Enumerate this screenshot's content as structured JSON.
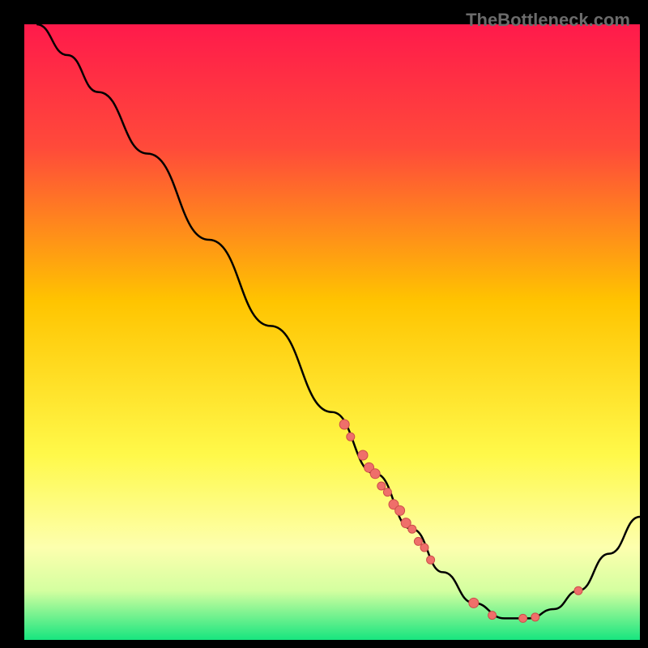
{
  "watermark": "TheBottleneck.com",
  "chart_data": {
    "type": "line",
    "title": "",
    "xlabel": "",
    "ylabel": "",
    "xlim": [
      0,
      100
    ],
    "ylim": [
      0,
      100
    ],
    "background_gradient": {
      "stops": [
        {
          "pct": 0,
          "color": "#ff1a4b"
        },
        {
          "pct": 20,
          "color": "#ff4a3a"
        },
        {
          "pct": 45,
          "color": "#ffc400"
        },
        {
          "pct": 70,
          "color": "#fff94a"
        },
        {
          "pct": 85,
          "color": "#fdffae"
        },
        {
          "pct": 92,
          "color": "#d4ffa0"
        },
        {
          "pct": 100,
          "color": "#17e57f"
        }
      ]
    },
    "curve": [
      {
        "x": 2,
        "y": 100
      },
      {
        "x": 7,
        "y": 95
      },
      {
        "x": 12,
        "y": 89
      },
      {
        "x": 20,
        "y": 79
      },
      {
        "x": 30,
        "y": 65
      },
      {
        "x": 40,
        "y": 51
      },
      {
        "x": 50,
        "y": 37
      },
      {
        "x": 57,
        "y": 27
      },
      {
        "x": 63,
        "y": 18
      },
      {
        "x": 68,
        "y": 11
      },
      {
        "x": 73,
        "y": 6
      },
      {
        "x": 78,
        "y": 3.5
      },
      {
        "x": 82,
        "y": 3.5
      },
      {
        "x": 86,
        "y": 5
      },
      {
        "x": 90,
        "y": 8
      },
      {
        "x": 95,
        "y": 14
      },
      {
        "x": 100,
        "y": 20
      }
    ],
    "points": [
      {
        "x": 52,
        "y": 35,
        "r": 6
      },
      {
        "x": 53,
        "y": 33,
        "r": 5
      },
      {
        "x": 55,
        "y": 30,
        "r": 6
      },
      {
        "x": 56,
        "y": 28,
        "r": 6
      },
      {
        "x": 57,
        "y": 27,
        "r": 6
      },
      {
        "x": 58,
        "y": 25,
        "r": 5
      },
      {
        "x": 59,
        "y": 24,
        "r": 5
      },
      {
        "x": 60,
        "y": 22,
        "r": 6
      },
      {
        "x": 61,
        "y": 21,
        "r": 6
      },
      {
        "x": 62,
        "y": 19,
        "r": 6
      },
      {
        "x": 63,
        "y": 18,
        "r": 5
      },
      {
        "x": 64,
        "y": 16,
        "r": 5
      },
      {
        "x": 65,
        "y": 15,
        "r": 5
      },
      {
        "x": 66,
        "y": 13,
        "r": 5
      },
      {
        "x": 73,
        "y": 6,
        "r": 6
      },
      {
        "x": 76,
        "y": 4,
        "r": 5
      },
      {
        "x": 81,
        "y": 3.5,
        "r": 5
      },
      {
        "x": 83,
        "y": 3.7,
        "r": 5
      },
      {
        "x": 90,
        "y": 8,
        "r": 5
      }
    ],
    "colors": {
      "curve": "#000000",
      "point_fill": "#ef6f6a",
      "point_stroke": "#cc4e4a"
    }
  }
}
